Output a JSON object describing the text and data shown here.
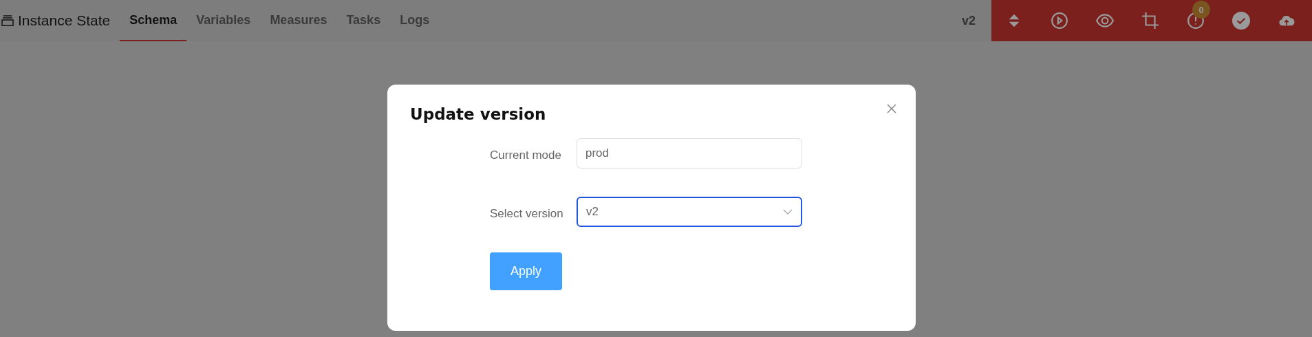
{
  "app": {
    "title": "Instance State"
  },
  "tabs": [
    {
      "label": "Schema",
      "selected": true
    },
    {
      "label": "Variables",
      "selected": false
    },
    {
      "label": "Measures",
      "selected": false
    },
    {
      "label": "Tasks",
      "selected": false
    },
    {
      "label": "Logs",
      "selected": false
    }
  ],
  "version": "v2",
  "toolbar": {
    "alert_count": "0"
  },
  "dialog": {
    "title": "Update version",
    "fields": [
      {
        "kind": "text",
        "label": "Current mode",
        "value": "prod",
        "focused": false
      },
      {
        "kind": "select",
        "label": "Select version",
        "value": "v2",
        "focused": true
      }
    ],
    "button": "Apply"
  }
}
